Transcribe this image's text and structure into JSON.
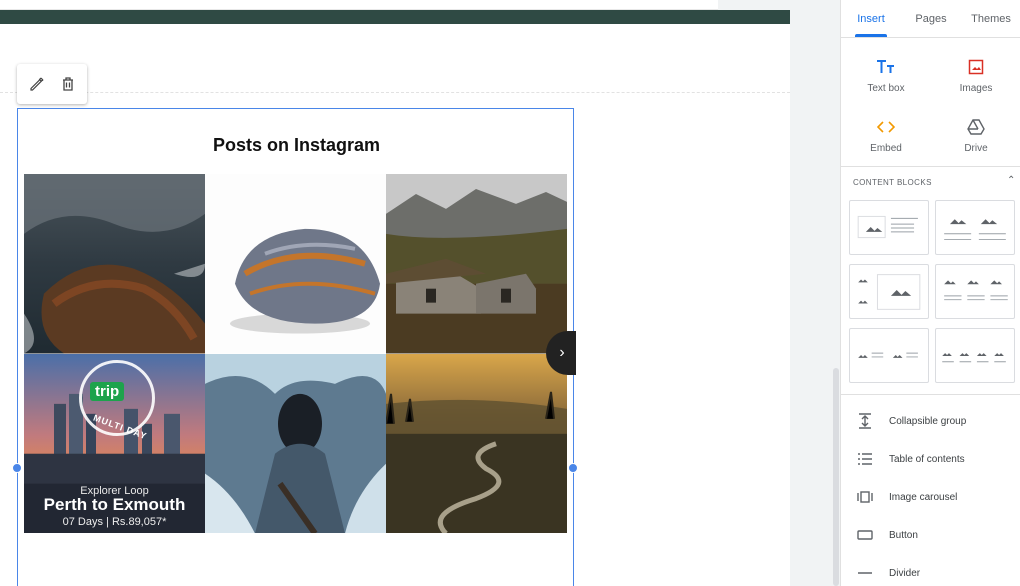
{
  "toolbar": {
    "edit_icon": "pencil-icon",
    "delete_icon": "trash-icon"
  },
  "embed": {
    "title": "Posts on Instagram",
    "promo": {
      "logo": "trip",
      "badge": "MULTI DAY",
      "subtitle": "Explorer Loop",
      "headline": "Perth to Exmouth",
      "price_line": "07 Days | Rs.89,057*"
    },
    "next_icon": "chevron-right-icon"
  },
  "panel": {
    "tabs": [
      {
        "label": "Insert"
      },
      {
        "label": "Pages"
      },
      {
        "label": "Themes"
      }
    ],
    "insert_items": [
      {
        "label": "Text box",
        "icon": "text-box-icon"
      },
      {
        "label": "Images",
        "icon": "image-icon"
      },
      {
        "label": "Embed",
        "icon": "code-icon"
      },
      {
        "label": "Drive",
        "icon": "drive-icon"
      }
    ],
    "content_blocks_label": "CONTENT BLOCKS",
    "list_items": [
      {
        "label": "Collapsible group",
        "icon": "collapsible-icon"
      },
      {
        "label": "Table of contents",
        "icon": "list-icon"
      },
      {
        "label": "Image carousel",
        "icon": "carousel-icon"
      },
      {
        "label": "Button",
        "icon": "button-icon"
      },
      {
        "label": "Divider",
        "icon": "divider-icon"
      }
    ]
  },
  "colors": {
    "accent": "#1a73e8",
    "banner": "#2f4a44",
    "selection": "#4a86e8"
  }
}
